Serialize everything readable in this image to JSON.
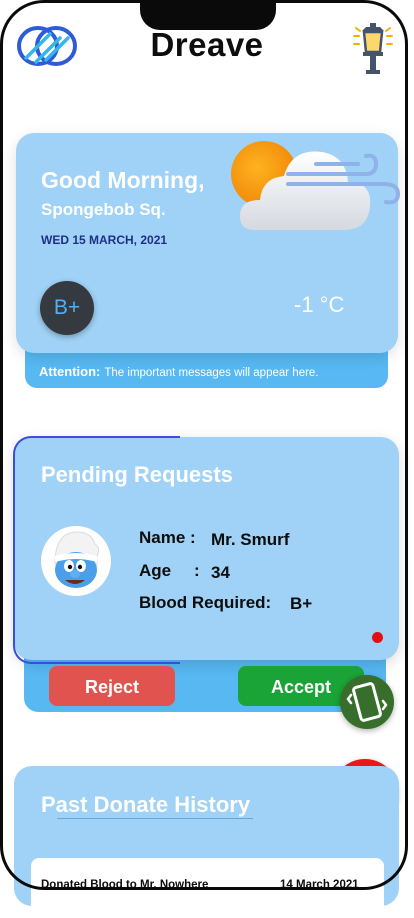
{
  "app": {
    "title": "Dreave"
  },
  "icons": {
    "logo": "double-ring-logo-icon",
    "lamp": "street-lamp-icon",
    "weather": "sun-cloud-wind-icon",
    "vibrate": "vibrate-phone-icon",
    "alarm": "alarm-broadcast-icon"
  },
  "greeting": {
    "title": "Good Morning,",
    "name": "Spongebob Sq.",
    "date": "WED 15 MARCH, 2021",
    "blood_group": "B+",
    "temperature": "-1 °C"
  },
  "attention": {
    "label": "Attention:",
    "message": "The important messages will appear here."
  },
  "pending": {
    "title": "Pending Requests",
    "name_label": "Name :",
    "name_value": "Mr. Smurf",
    "age_label": "Age",
    "age_colon": ":",
    "age_value": "34",
    "blood_label": "Blood Required:",
    "blood_value": "B+",
    "reject_label": "Reject",
    "accept_label": "Accept"
  },
  "history": {
    "title": "Past Donate History",
    "items": [
      {
        "text": "Donated Blood to Mr. Nowhere",
        "date": "14 March 2021"
      }
    ]
  },
  "colors": {
    "card": "#9fd2f6",
    "card_dark": "#57b8f2",
    "reject": "#e0534f",
    "accept": "#1aa336",
    "alarm": "#f01515",
    "vibrate": "#386e2b"
  }
}
